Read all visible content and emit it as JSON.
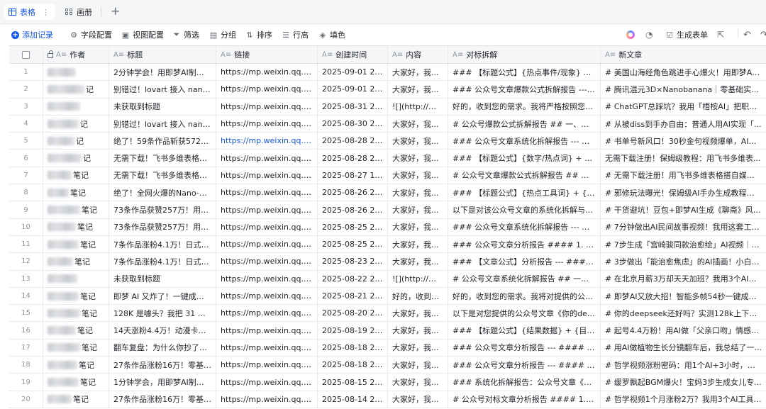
{
  "view_tabs": [
    {
      "label": "表格",
      "icon": "grid-icon",
      "active": true
    },
    {
      "label": "画册",
      "icon": "gallery-icon",
      "active": false
    }
  ],
  "toolbar": {
    "add_record": "添加记录",
    "field_config": "字段配置",
    "view_config": "视图配置",
    "filter": "筛选",
    "group": "分组",
    "sort": "排序",
    "row_height": "行高",
    "fill_color": "填色",
    "generate_form": "生成表单"
  },
  "columns": [
    {
      "key": "author",
      "label": "作者",
      "type_icon": "A≡",
      "locked": true
    },
    {
      "key": "title",
      "label": "标题",
      "type_icon": "A≡"
    },
    {
      "key": "link",
      "label": "链接",
      "type_icon": "A≡"
    },
    {
      "key": "created",
      "label": "创建时间",
      "type_icon": "A≡"
    },
    {
      "key": "content",
      "label": "内容",
      "type_icon": "A≡"
    },
    {
      "key": "analysis",
      "label": "对标拆解",
      "type_icon": "A≡"
    },
    {
      "key": "new_article",
      "label": "新文章",
      "type_icon": "A≡"
    }
  ],
  "rows": [
    {
      "n": "1",
      "author": "",
      "title": "2分钟学会！用即梦AI制作万...",
      "link": "https://mp.weixin.qq.co...",
      "created": "2025-09-01 21:...",
      "content": "大家好，我...",
      "analysis": "### 【标题公式】{热点事件/现象} + {工...",
      "new_article": "# 美国山海经角色跳进手心爆火！用即梦AI3..."
    },
    {
      "n": "2",
      "author": "记",
      "title": "别错过！lovart 接入 nanoba...",
      "link": "https://mp.weixin.qq.co...",
      "created": "2025-09-01 21:...",
      "content": "大家好，我...",
      "analysis": "### 公众号文章爆款公式拆解报告 --- #...",
      "new_article": "# 腾讯混元3D×Nanobanana｜零基础实现真..."
    },
    {
      "n": "3",
      "author": "",
      "title": "未获取到标题",
      "link": "https://mp.weixin.qq.co...",
      "created": "2025-08-31 21:...",
      "content": "![](http://mm...",
      "analysis": "好的，收到您的需求。我将严格按照您提...",
      "new_article": "# ChatGPT总踩坑？我用「梧桉AI」把职场..."
    },
    {
      "n": "4",
      "author": "记",
      "title": "别错过！lovart 接入 nanoba...",
      "link": "https://mp.weixin.qq.co...",
      "created": "2025-08-30 20:...",
      "content": "大家好，我...",
      "analysis": "# 公众号爆款公式拆解报告 ## 一、基础...",
      "new_article": "# 从被diss到手办自由：普通人用AI实现「..."
    },
    {
      "n": "5",
      "author": "记",
      "title": "绝了！59条作品斩获572万...",
      "link": "https://mp.weixin.qq.co...",
      "created": "2025-08-28 22:...",
      "content": "大家好，我...",
      "analysis": "### 公众号文章系统化拆解报告 --- ###...",
      "new_article": "# 书单号新风口！30秒金句视频爆单，AI工..."
    },
    {
      "n": "6",
      "author": "记",
      "title": "无需下载！飞书多维表格独...",
      "link": "https://mp.weixin.qq.co...",
      "created": "2025-08-28 22:...",
      "content": "大家好，我...",
      "analysis": "### 【标题公式】{数字/热点词} + {核心...",
      "new_article": "无需下载注册！保姆级教程：用飞书多维表..."
    },
    {
      "n": "7",
      "author": "笔记",
      "title": "无需下载！飞书多维表格独...",
      "link": "https://mp.weixin.qq.co...",
      "created": "2025-08-27 10:...",
      "content": "大家好，我...",
      "analysis": "# 公众号文章爆款公式拆解报告 ## 一、...",
      "new_article": "# 无需下载注册！用飞书多维表格搭自媒体..."
    },
    {
      "n": "8",
      "author": "笔记",
      "title": "绝了！全网火爆的Nano-ban...",
      "link": "https://mp.weixin.qq.co...",
      "created": "2025-08-26 20:...",
      "content": "大家好，我...",
      "analysis": "### 【标题公式】{热点工具词} + {颠覆...",
      "new_article": "# 邪修玩法曝光！保姆级AI手办生成教程，n..."
    },
    {
      "n": "9",
      "author": "笔记",
      "title": "73条作品获赞257万！用AI...",
      "link": "https://mp.weixin.qq.co...",
      "created": "2025-08-26 20:...",
      "content": "大家好，我...",
      "analysis": "以下是对该公众号文章的系统化拆解与分...",
      "new_article": "# 干货避坑！豆包+即梦AI生成《聊斋》风视..."
    },
    {
      "n": "10",
      "author": "笔记",
      "title": "73条作品获赞257万！用AI...",
      "link": "https://mp.weixin.qq.co...",
      "created": "2025-08-25 22:...",
      "content": "大家好，我...",
      "analysis": "### 公众号文章系统化拆解报告 --- ###...",
      "new_article": "# 7分钟做出AI民间故事视频！我用这套工具..."
    },
    {
      "n": "11",
      "author": "笔记",
      "title": "7条作品涨粉4.1万！日式治...",
      "link": "https://mp.weixin.qq.co...",
      "created": "2025-08-25 22:...",
      "content": "大家好，我...",
      "analysis": "### 公众号文章分析报告 #### 1. 基础结...",
      "new_article": "# 7步生成「宫崎骏同款治愈绘」AI视频｜单..."
    },
    {
      "n": "12",
      "author": "笔记",
      "title": "7条作品涨粉4.1万！日式治...",
      "link": "https://mp.weixin.qq.co...",
      "created": "2025-08-23 21:...",
      "content": "大家好，我...",
      "analysis": "### 【文章公式】分析报告 --- #### 🔍 ...",
      "new_article": "# 3步做出「能治愈焦虑」的AI插画！小白也..."
    },
    {
      "n": "13",
      "author": "",
      "title": "未获取到标题",
      "link": "https://mp.weixin.qq.co...",
      "created": "2025-08-22 22:...",
      "content": "![](http://mm...",
      "analysis": "# 公众号文章系统化拆解报告 ## 一、基...",
      "new_article": "# 在北京月薪3万却天天加班？我用3个AI工..."
    },
    {
      "n": "14",
      "author": "笔记",
      "title": "即梦 AI 又炸了！一键成片5...",
      "link": "https://mp.weixin.qq.co...",
      "created": "2025-08-21 21:...",
      "content": "好的，收到您的需求。我将对提供的公众...",
      "analysis": "好的，收到您的需求。我将对提供的公众...",
      "new_article": "# 即梦AI又放大招！智能多帧54秒一键成视..."
    },
    {
      "n": "15",
      "author": "笔记",
      "title": "128K 是噱头？我把 31 万字...",
      "link": "https://mp.weixin.qq.co...",
      "created": "2025-08-20 23:...",
      "content": "大家好，我...",
      "analysis": "以下是对您提供的公众号文章《你的dee...",
      "new_article": "# 你的deepseek还好吗？实测128k上下文，..."
    },
    {
      "n": "16",
      "author": "笔记",
      "title": "14天涨粉4.4万！动漫卡通情...",
      "link": "https://mp.weixin.qq.co...",
      "created": "2025-08-19 20:...",
      "content": "大家好，我...",
      "analysis": "### 【标题公式】{结果数据} + {目标人...",
      "new_article": "# 起号4.4万粉！用AI做「父亲口吻」情感短..."
    },
    {
      "n": "17",
      "author": "笔记",
      "title": "翻车复盘：为什么你抄了提...",
      "link": "https://mp.weixin.qq.co...",
      "created": "2025-08-18 20:...",
      "content": "大家好，我...",
      "analysis": "### 公众号文章分析报告 --- #### 🔍 ...",
      "new_article": "# 用AI做植物生长分镜翻车后，我总结了一..."
    },
    {
      "n": "18",
      "author": "笔记",
      "title": "27条作品涨粉16万！零基础...",
      "link": "https://mp.weixin.qq.co...",
      "created": "2025-08-18 20:...",
      "content": "大家好，我...",
      "analysis": "### 公众号文章分析报告 --- #### 🔍 ...",
      "new_article": "# 哲学视频涨粉密码：用1个AI+3小时，做\"..."
    },
    {
      "n": "19",
      "author": "笔记",
      "title": "1分钟学会，用即梦AI制作8...",
      "link": "https://mp.weixin.qq.co...",
      "created": "2025-08-15 22:...",
      "content": "大家好，我...",
      "analysis": "### 系统化拆解报告：公众号文章《AI动...",
      "new_article": "# 缓罗飘起BGM爆火！宝妈3步生成女儿专..."
    },
    {
      "n": "20",
      "author": "笔记",
      "title": "27条作品涨粉16万！零基础...",
      "link": "https://mp.weixin.qq.co...",
      "created": "2025-08-14 21:...",
      "content": "大家好，我...",
      "analysis": "# 公众号对标文章分析报告 #### 1. 基...",
      "new_article": "# 哲学视频1个月涨粉2万？我用3个AI工具搞..."
    }
  ]
}
